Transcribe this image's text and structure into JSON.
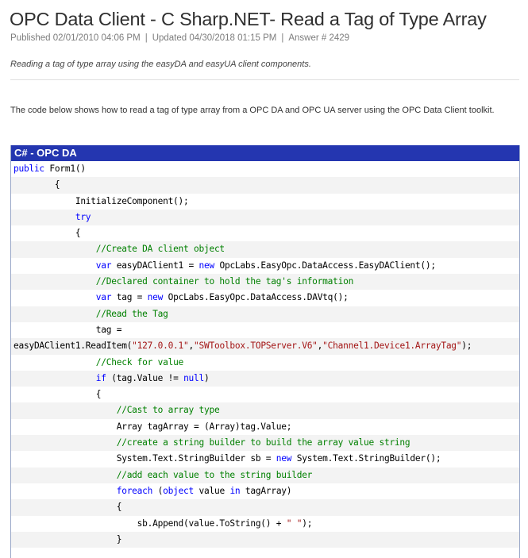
{
  "article": {
    "title": "OPC Data Client - C Sharp.NET- Read a Tag of Type Array",
    "meta": {
      "published": "Published 02/01/2010 04:06 PM",
      "separator": "|",
      "updated": "Updated 04/30/2018 01:15 PM",
      "answer": "Answer # 2429"
    },
    "summary": "Reading a tag of type array using the easyDA and easyUA client components.",
    "intro": "The code below shows how to read a tag of type array from a OPC DA and OPC UA server using the OPC Data Client toolkit."
  },
  "code_panel": {
    "header": "C# - OPC DA",
    "lines": [
      {
        "indent": 0,
        "tokens": [
          {
            "t": "kw",
            "v": "public"
          },
          {
            "t": "tx",
            "v": " Form1()"
          }
        ]
      },
      {
        "indent": 8,
        "tokens": [
          {
            "t": "tx",
            "v": "{"
          }
        ]
      },
      {
        "indent": 12,
        "tokens": [
          {
            "t": "tx",
            "v": "InitializeComponent();"
          }
        ]
      },
      {
        "indent": 12,
        "tokens": [
          {
            "t": "kw",
            "v": "try"
          }
        ]
      },
      {
        "indent": 12,
        "tokens": [
          {
            "t": "tx",
            "v": "{"
          }
        ]
      },
      {
        "indent": 16,
        "tokens": [
          {
            "t": "cm",
            "v": "//Create DA client object"
          }
        ]
      },
      {
        "indent": 16,
        "tokens": [
          {
            "t": "kw",
            "v": "var"
          },
          {
            "t": "tx",
            "v": " easyDAClient1 = "
          },
          {
            "t": "kw",
            "v": "new"
          },
          {
            "t": "tx",
            "v": " OpcLabs.EasyOpc.DataAccess.EasyDAClient();"
          }
        ]
      },
      {
        "indent": 16,
        "tokens": [
          {
            "t": "cm",
            "v": "//Declared container to hold the tag's information"
          }
        ]
      },
      {
        "indent": 16,
        "tokens": [
          {
            "t": "kw",
            "v": "var"
          },
          {
            "t": "tx",
            "v": " tag = "
          },
          {
            "t": "kw",
            "v": "new"
          },
          {
            "t": "tx",
            "v": " OpcLabs.EasyOpc.DataAccess.DAVtq();"
          }
        ]
      },
      {
        "indent": 16,
        "tokens": [
          {
            "t": "cm",
            "v": "//Read the Tag"
          }
        ]
      },
      {
        "indent": 16,
        "tokens": [
          {
            "t": "tx",
            "v": "tag ="
          }
        ]
      },
      {
        "indent": 0,
        "tokens": [
          {
            "t": "tx",
            "v": "easyDAClient1.ReadItem("
          },
          {
            "t": "st",
            "v": "\"127.0.0.1\""
          },
          {
            "t": "tx",
            "v": ","
          },
          {
            "t": "st",
            "v": "\"SWToolbox.TOPServer.V6\""
          },
          {
            "t": "tx",
            "v": ","
          },
          {
            "t": "st",
            "v": "\"Channel1.Device1.ArrayTag\""
          },
          {
            "t": "tx",
            "v": ");"
          }
        ]
      },
      {
        "indent": 16,
        "tokens": [
          {
            "t": "cm",
            "v": "//Check for value"
          }
        ]
      },
      {
        "indent": 16,
        "tokens": [
          {
            "t": "kw",
            "v": "if"
          },
          {
            "t": "tx",
            "v": " (tag.Value != "
          },
          {
            "t": "kw",
            "v": "null"
          },
          {
            "t": "tx",
            "v": ")"
          }
        ]
      },
      {
        "indent": 16,
        "tokens": [
          {
            "t": "tx",
            "v": "{"
          }
        ]
      },
      {
        "indent": 20,
        "tokens": [
          {
            "t": "cm",
            "v": "//Cast to array type"
          }
        ]
      },
      {
        "indent": 20,
        "tokens": [
          {
            "t": "tx",
            "v": "Array tagArray = (Array)tag.Value;"
          }
        ]
      },
      {
        "indent": 20,
        "tokens": [
          {
            "t": "cm",
            "v": "//create a string builder to build the array value string"
          }
        ]
      },
      {
        "indent": 20,
        "tokens": [
          {
            "t": "tx",
            "v": "System.Text.StringBuilder sb = "
          },
          {
            "t": "kw",
            "v": "new"
          },
          {
            "t": "tx",
            "v": " System.Text.StringBuilder();"
          }
        ]
      },
      {
        "indent": 20,
        "tokens": [
          {
            "t": "cm",
            "v": "//add each value to the string builder"
          }
        ]
      },
      {
        "indent": 20,
        "tokens": [
          {
            "t": "kw",
            "v": "foreach"
          },
          {
            "t": "tx",
            "v": " ("
          },
          {
            "t": "kw",
            "v": "object"
          },
          {
            "t": "tx",
            "v": " value "
          },
          {
            "t": "kw",
            "v": "in"
          },
          {
            "t": "tx",
            "v": " tagArray)"
          }
        ]
      },
      {
        "indent": 20,
        "tokens": [
          {
            "t": "tx",
            "v": "{"
          }
        ]
      },
      {
        "indent": 24,
        "tokens": [
          {
            "t": "tx",
            "v": "sb.Append(value.ToString() + "
          },
          {
            "t": "st",
            "v": "\" \""
          },
          {
            "t": "tx",
            "v": ");"
          }
        ]
      },
      {
        "indent": 20,
        "tokens": [
          {
            "t": "tx",
            "v": "}"
          }
        ]
      }
    ]
  },
  "colors": {
    "header_bg": "#2436b0",
    "keyword": "#0000ff",
    "comment": "#008000",
    "string": "#a31515"
  }
}
